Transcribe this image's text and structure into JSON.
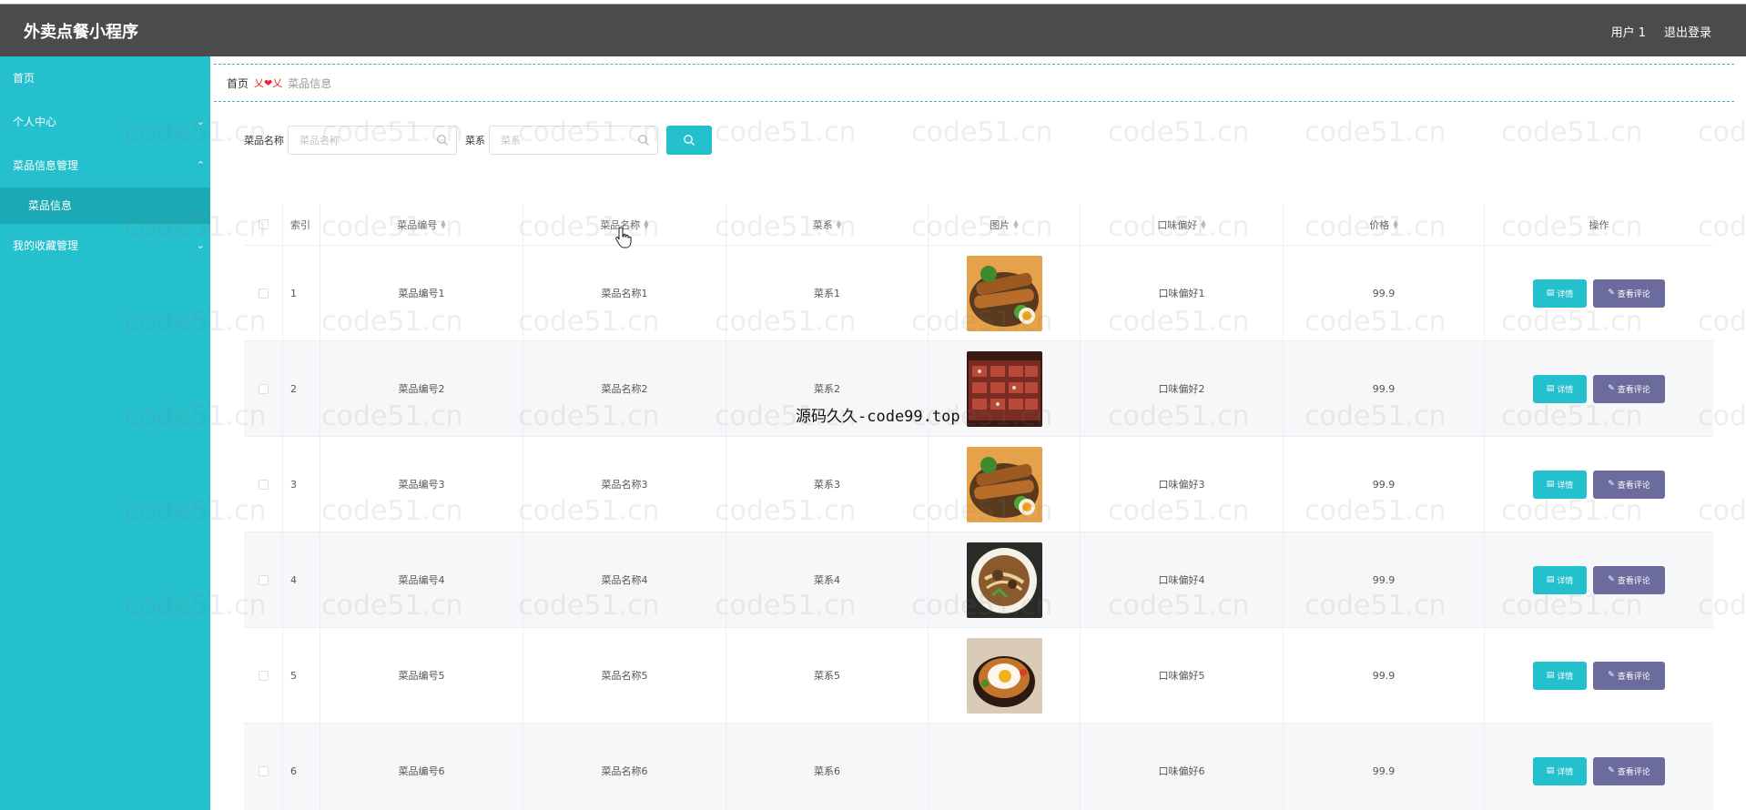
{
  "app": {
    "title": "外卖点餐小程序",
    "user": "用户 1",
    "logout": "退出登录"
  },
  "sidebar": {
    "items": [
      {
        "label": "首页",
        "chevron": ""
      },
      {
        "label": "个人中心",
        "chevron": "⌄"
      },
      {
        "label": "菜品信息管理",
        "chevron": "⌃"
      },
      {
        "label": "我的收藏管理",
        "chevron": "⌄"
      }
    ],
    "sub_item": "菜品信息"
  },
  "breadcrumb": {
    "home": "首页",
    "separator": "乂❤乂",
    "current": "菜品信息"
  },
  "search": {
    "name_label": "菜品名称",
    "name_placeholder": "菜品名称",
    "category_label": "菜系",
    "category_placeholder": "菜系",
    "button_icon": "search-icon"
  },
  "table": {
    "headers": [
      "索引",
      "菜品编号",
      "菜品名称",
      "菜系",
      "图片",
      "口味偏好",
      "价格",
      "操作"
    ],
    "rows": [
      {
        "index": "1",
        "code": "菜品编号1",
        "name": "菜品名称1",
        "category": "菜系1",
        "taste": "口味偏好1",
        "price": "99.9",
        "image": "grilled-skewers-plate"
      },
      {
        "index": "2",
        "code": "菜品编号2",
        "name": "菜品名称2",
        "category": "菜系2",
        "taste": "口味偏好2",
        "price": "99.9",
        "image": "grilled-meat-board"
      },
      {
        "index": "3",
        "code": "菜品编号3",
        "name": "菜品名称3",
        "category": "菜系3",
        "taste": "口味偏好3",
        "price": "99.9",
        "image": "grilled-skewers-plate"
      },
      {
        "index": "4",
        "code": "菜品编号4",
        "name": "菜品名称4",
        "category": "菜系4",
        "taste": "口味偏好4",
        "price": "99.9",
        "image": "noodle-bowl"
      },
      {
        "index": "5",
        "code": "菜品编号5",
        "name": "菜品名称5",
        "category": "菜系5",
        "taste": "口味偏好5",
        "price": "99.9",
        "image": "fried-egg-bowl"
      },
      {
        "index": "6",
        "code": "菜品编号6",
        "name": "菜品名称6",
        "category": "菜系6",
        "taste": "口味偏好6",
        "price": "99.9",
        "image": ""
      }
    ],
    "detail_label": "详情",
    "comment_label": "查看评论"
  },
  "overlay_text": "源码久久-code99.top",
  "watermark": "code51.cn",
  "colors": {
    "accent": "#25c0cd",
    "topbar": "#4b4b4b",
    "comment_button": "#6c6b9d"
  }
}
